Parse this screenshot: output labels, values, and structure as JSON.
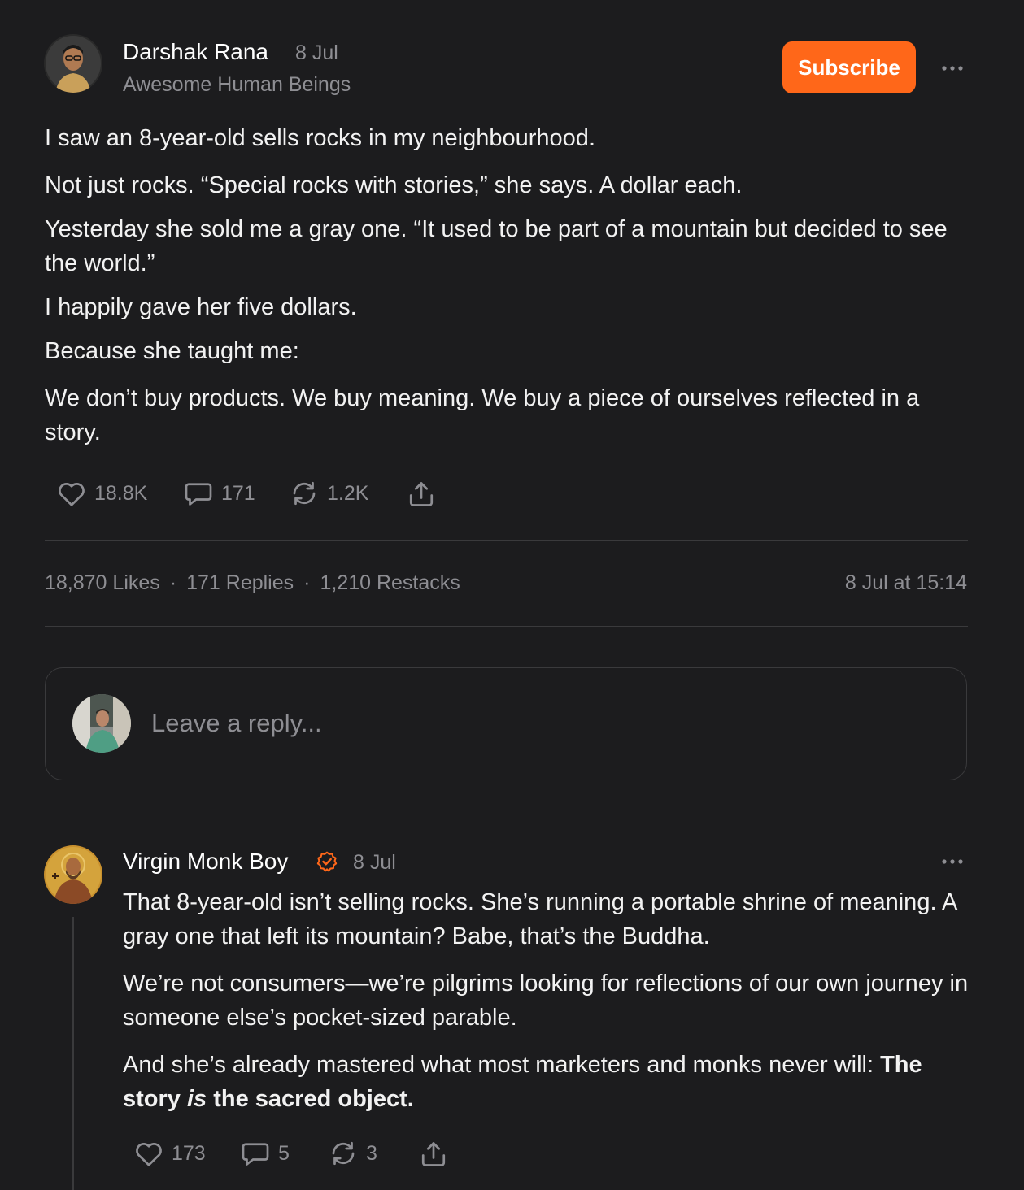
{
  "post": {
    "author": "Darshak Rana",
    "date": "8 Jul",
    "publication": "Awesome Human Beings",
    "subscribe_label": "Subscribe",
    "paragraphs": [
      "I saw an 8-year-old sells rocks in my neighbourhood.",
      "Not just rocks. “Special rocks with stories,” she says. A dollar each.",
      "Yesterday she sold me a gray one. “It used to be part of a mountain but decided to see the world.”",
      "I happily gave her five dollars.",
      "Because she taught me:",
      "We don’t buy products. We buy meaning. We buy a piece of ourselves reflected in a story."
    ],
    "actions": {
      "likes": "18.8K",
      "replies": "171",
      "restacks": "1.2K"
    },
    "stats": {
      "likes": "18,870 Likes",
      "replies": "171 Replies",
      "restacks": "1,210 Restacks",
      "separator": "·",
      "timestamp": "8 Jul at 15:14"
    }
  },
  "reply_box": {
    "placeholder": "Leave a reply..."
  },
  "comment": {
    "author": "Virgin Monk Boy",
    "date": "8 Jul",
    "paragraph1": "That 8-year-old isn’t selling rocks. She’s running a portable shrine of meaning. A gray one that left its mountain? Babe, that’s the Buddha.",
    "paragraph2": "We’re not consumers—we’re pilgrims looking for reflections of our own journey in someone else’s pocket-sized parable.",
    "paragraph3_plain": "And she’s already mastered what most marketers and monks never will: ",
    "paragraph3_bold_1": "The story ",
    "paragraph3_bold_italic": "is",
    "paragraph3_bold_2": " the sacred object.",
    "actions": {
      "likes": "173",
      "replies": "5",
      "restacks": "3"
    }
  },
  "colors": {
    "background": "#1c1c1e",
    "accent": "#ff6719",
    "muted_text": "#8e8e93",
    "divider": "#3a3a3c"
  }
}
